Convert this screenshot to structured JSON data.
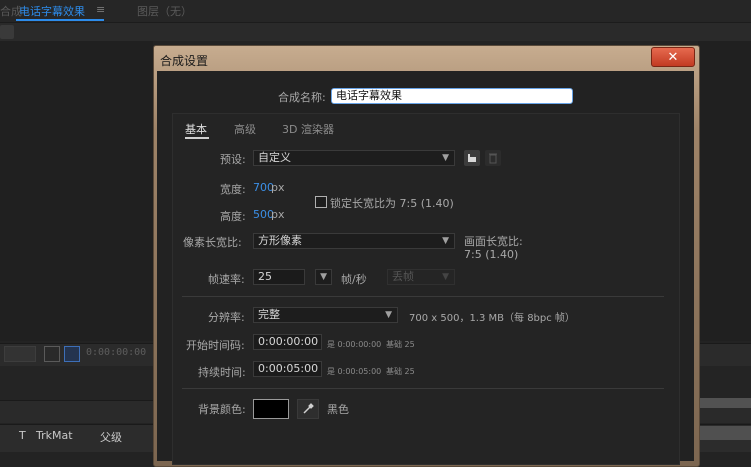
{
  "background": {
    "tabs": {
      "left_fragment": "合成",
      "active": "电话字幕效果",
      "menu_glyph": "≡",
      "layer_panel": "图层（无）"
    },
    "timecode": "0:00:00:00",
    "columns": {
      "t": "T",
      "trkmat": "TrkMat",
      "parent": "父级"
    }
  },
  "dialog": {
    "title": "合成设置",
    "close_glyph": "✕",
    "comp_name_label": "合成名称:",
    "comp_name_value": "电话字幕效果",
    "tabs": [
      "基本",
      "高级",
      "3D 渲染器"
    ],
    "preset": {
      "label": "预设:",
      "value": "自定义"
    },
    "width": {
      "label": "宽度:",
      "value": "700",
      "unit": "px"
    },
    "height": {
      "label": "高度:",
      "value": "500",
      "unit": "px"
    },
    "lock_aspect": {
      "label": "锁定长宽比为 7:5 (1.40)",
      "checked": false
    },
    "pixel_aspect": {
      "label": "像素长宽比:",
      "value": "方形像素"
    },
    "frame_aspect": {
      "label": "画面长宽比:",
      "value": "7:5 (1.40)"
    },
    "frame_rate": {
      "label": "帧速率:",
      "value": "25",
      "unit": "帧/秒",
      "drop_frame": "丢帧"
    },
    "resolution": {
      "label": "分辨率:",
      "value": "完整",
      "info": "700 x 500，1.3 MB（每 8bpc 帧）"
    },
    "start_timecode": {
      "label": "开始时间码:",
      "value": "0:00:00:00",
      "note1": "是 0:00:00:00",
      "note2": "基础 25"
    },
    "duration": {
      "label": "持续时间:",
      "value": "0:00:05:00",
      "note1": "是 0:00:05:00",
      "note2": "基础 25"
    },
    "bg_color": {
      "label": "背景颜色:",
      "name": "黑色",
      "color": "#000000"
    }
  }
}
